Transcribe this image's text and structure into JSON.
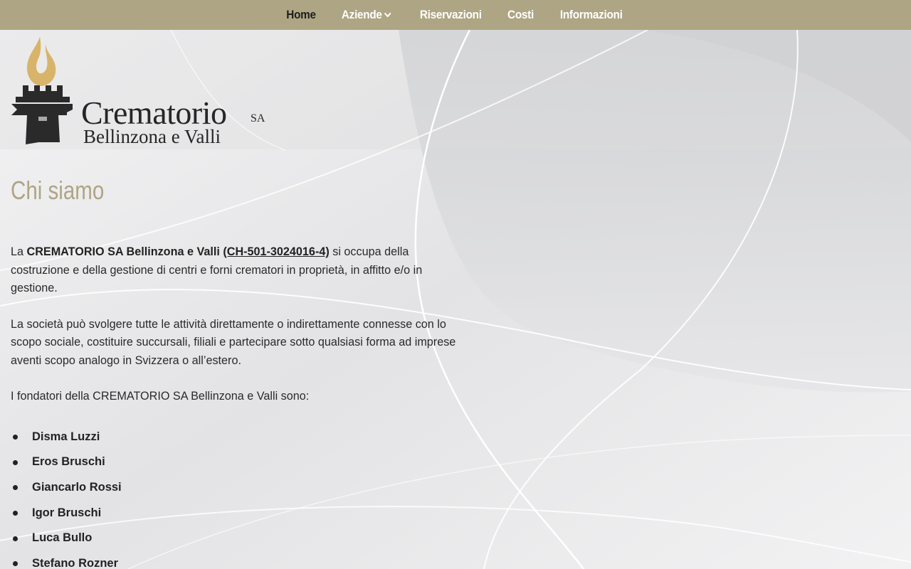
{
  "nav": {
    "items": [
      {
        "label": "Home",
        "active": true
      },
      {
        "label": "Aziende",
        "has_dropdown": true
      },
      {
        "label": "Riservazioni"
      },
      {
        "label": "Costi"
      },
      {
        "label": "Informazioni"
      }
    ]
  },
  "logo": {
    "title": "Crematorio",
    "suffix": "SA",
    "subtitle": "Bellinzona e Valli"
  },
  "main": {
    "title": "Chi siamo",
    "paragraph1": {
      "prefix": "La ",
      "company": "CREMATORIO SA Bellinzona e Valli",
      "registry_link": "(CH-501-3024016-4)",
      "suffix": " si occupa della costruzione e della gestione di centri e forni crematori in proprietà, in affitto e/o in gestione."
    },
    "paragraph2": "La società può svolgere tutte le attività direttamente o indirettamente connesse con lo scopo sociale, costituire succursali, filiali e partecipare sotto qualsiasi forma ad imprese aventi scopo analogo in Svizzera o all’estero.",
    "paragraph3": "I fondatori della CREMATORIO SA Bellinzona e Valli sono:",
    "founders": [
      "Disma Luzzi",
      "Eros Bruschi",
      "Giancarlo Rossi",
      "Igor Bruschi",
      "Luca Bullo",
      "Stefano Rozner"
    ]
  },
  "colors": {
    "nav_bg": "#aea584",
    "title": "#aea584",
    "logo_flame": "#d8b46a",
    "text": "#2a2a2a"
  },
  "icons": {
    "dropdown": "chevron-down-icon",
    "logo": "torch-tower-icon"
  }
}
